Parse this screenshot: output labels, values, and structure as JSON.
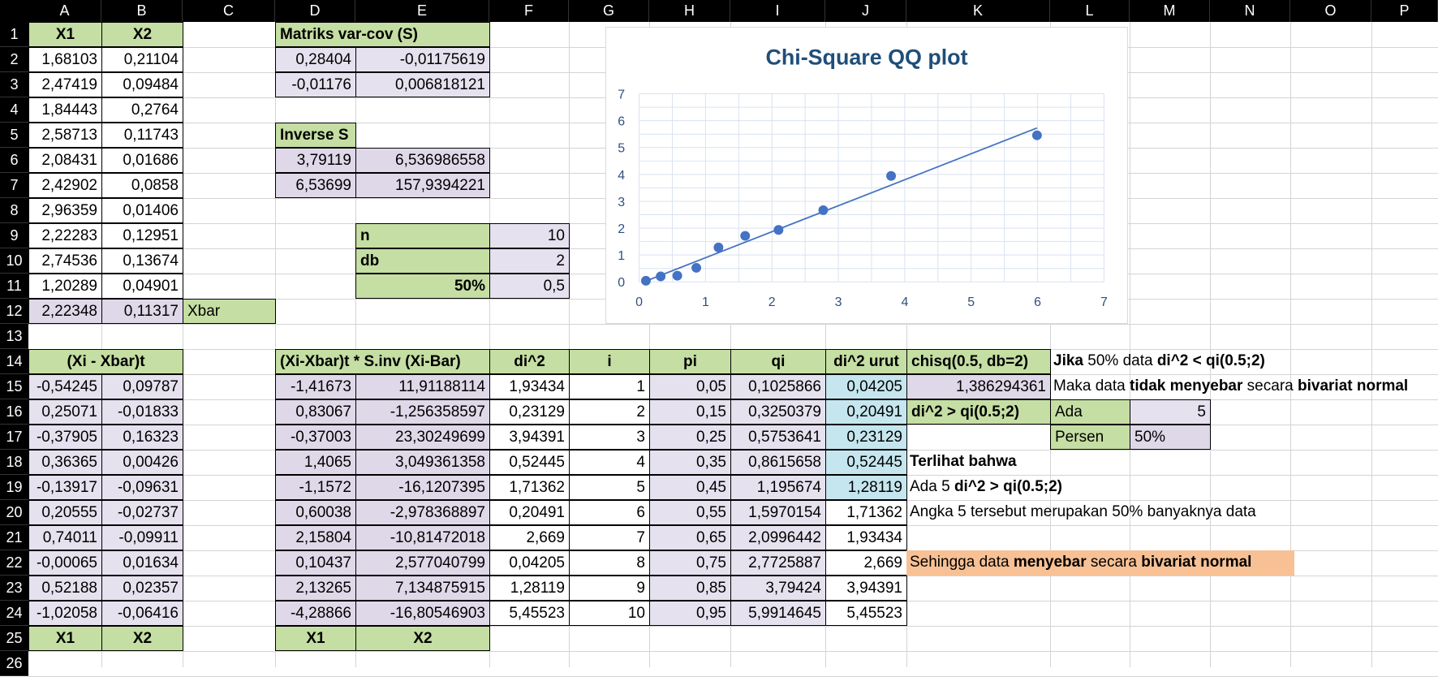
{
  "columns": [
    "A",
    "B",
    "C",
    "D",
    "E",
    "F",
    "G",
    "H",
    "I",
    "J",
    "K",
    "L",
    "M",
    "N",
    "O",
    "P"
  ],
  "rows": [
    "1",
    "2",
    "3",
    "4",
    "5",
    "6",
    "7",
    "8",
    "9",
    "10",
    "11",
    "12",
    "13",
    "14",
    "15",
    "16",
    "17",
    "18",
    "19",
    "20",
    "21",
    "22",
    "23",
    "24",
    "25",
    "26"
  ],
  "top_table": {
    "headers": [
      "X1",
      "X2"
    ],
    "rows": [
      [
        "1,68103",
        "0,21104"
      ],
      [
        "2,47419",
        "0,09484"
      ],
      [
        "1,84443",
        "0,2764"
      ],
      [
        "2,58713",
        "0,11743"
      ],
      [
        "2,08431",
        "0,01686"
      ],
      [
        "2,42902",
        "0,0858"
      ],
      [
        "2,96359",
        "0,01406"
      ],
      [
        "2,22283",
        "0,12951"
      ],
      [
        "2,74536",
        "0,13674"
      ],
      [
        "1,20289",
        "0,04901"
      ]
    ],
    "xbar": [
      "2,22348",
      "0,11317"
    ],
    "xbar_label": "Xbar"
  },
  "varcov": {
    "title": "Matriks var-cov (S)",
    "rows": [
      [
        "0,28404",
        "-0,01175619"
      ],
      [
        "-0,01176",
        "0,006818121"
      ]
    ]
  },
  "inverse": {
    "title": "Inverse S",
    "rows": [
      [
        "3,79119",
        "6,536986558"
      ],
      [
        "6,53699",
        "157,9394221"
      ]
    ]
  },
  "params": {
    "n_label": "n",
    "n_value": "10",
    "db_label": "db",
    "db_value": "2",
    "pct_label": "50%",
    "pct_value": "0,5"
  },
  "lower": {
    "dev_header": "(Xi - Xbar)t",
    "dev_rows": [
      [
        "-0,54245",
        "0,09787"
      ],
      [
        "0,25071",
        "-0,01833"
      ],
      [
        "-0,37905",
        "0,16323"
      ],
      [
        "0,36365",
        "0,00426"
      ],
      [
        "-0,13917",
        "-0,09631"
      ],
      [
        "0,20555",
        "-0,02737"
      ],
      [
        "0,74011",
        "-0,09911"
      ],
      [
        "-0,00065",
        "0,01634"
      ],
      [
        "0,52188",
        "0,02357"
      ],
      [
        "-1,02058",
        "-0,06416"
      ]
    ],
    "dev_footer": [
      "X1",
      "X2"
    ],
    "prod_header": "(Xi-Xbar)t * S.inv (Xi-Bar)",
    "prod_rows": [
      [
        "-1,41673",
        "11,91188114"
      ],
      [
        "0,83067",
        "-1,256358597"
      ],
      [
        "-0,37003",
        "23,30249699"
      ],
      [
        "1,4065",
        "3,049361358"
      ],
      [
        "-1,1572",
        "-16,1207395"
      ],
      [
        "0,60038",
        "-2,978368897"
      ],
      [
        "2,15804",
        "-10,81472018"
      ],
      [
        "0,10437",
        "2,577040799"
      ],
      [
        "2,13265",
        "7,134875915"
      ],
      [
        "-4,28866",
        "-16,80546903"
      ]
    ],
    "prod_footer": [
      "X1",
      "X2"
    ],
    "di2_header": "di^2",
    "di2": [
      "1,93434",
      "0,23129",
      "3,94391",
      "0,52445",
      "1,71362",
      "0,20491",
      "2,669",
      "0,04205",
      "1,28119",
      "5,45523"
    ],
    "i_header": "i",
    "i": [
      "1",
      "2",
      "3",
      "4",
      "5",
      "6",
      "7",
      "8",
      "9",
      "10"
    ],
    "pi_header": "pi",
    "pi": [
      "0,05",
      "0,15",
      "0,25",
      "0,35",
      "0,45",
      "0,55",
      "0,65",
      "0,75",
      "0,85",
      "0,95"
    ],
    "qi_header": "qi",
    "qi": [
      "0,1025866",
      "0,3250379",
      "0,5753641",
      "0,8615658",
      "1,195674",
      "1,5970154",
      "2,0996442",
      "2,7725887",
      "3,79424",
      "5,9914645"
    ],
    "sorted_header": "di^2 urut",
    "sorted": [
      "0,04205",
      "0,20491",
      "0,23129",
      "0,52445",
      "1,28119",
      "1,71362",
      "1,93434",
      "2,669",
      "3,94391",
      "5,45523"
    ]
  },
  "side": {
    "chisq_header": "chisq(0.5, db=2)",
    "chisq_value": "1,386294361",
    "cmp_label": "di^2 > qi(0.5;2)",
    "ada_label": "Ada",
    "ada_value": "5",
    "persen_label": "Persen",
    "persen_value": "50%",
    "rule1_a": "Jika",
    "rule1_b": " 50% data ",
    "rule1_c": "di^2 < qi(0.5;2)",
    "rule2_a": "Maka data ",
    "rule2_b": "tidak menyebar",
    "rule2_c": " secara ",
    "rule2_d": "bivariat normal",
    "obs_title": "Terlihat bahwa",
    "obs1_a": "Ada 5 ",
    "obs1_b": "di^2 > qi(0.5;2)",
    "obs2": "Angka 5 tersebut merupakan 50% banyaknya data",
    "concl_a": "Sehingga data ",
    "concl_b": "menyebar",
    "concl_c": " secara ",
    "concl_d": "bivariat normal"
  },
  "chart_data": {
    "type": "scatter",
    "title": "Chi-Square QQ plot",
    "x": [
      0.1025866,
      0.3250379,
      0.5753641,
      0.8615658,
      1.195674,
      1.5970154,
      2.0996442,
      2.7725887,
      3.79424,
      5.9914645
    ],
    "y": [
      0.04205,
      0.20491,
      0.23129,
      0.52445,
      1.28119,
      1.71362,
      1.93434,
      2.669,
      3.94391,
      5.45523
    ],
    "xlim": [
      0,
      7
    ],
    "ylim": [
      0,
      7
    ],
    "xticks": [
      "0",
      "1",
      "2",
      "3",
      "4",
      "5",
      "6",
      "7"
    ],
    "yticks": [
      "0",
      "1",
      "2",
      "3",
      "4",
      "5",
      "6",
      "7"
    ],
    "trendline": true,
    "grid": true,
    "point_color": "#4472c4",
    "line_color": "#4472c4",
    "title_color": "#1f4e79"
  }
}
